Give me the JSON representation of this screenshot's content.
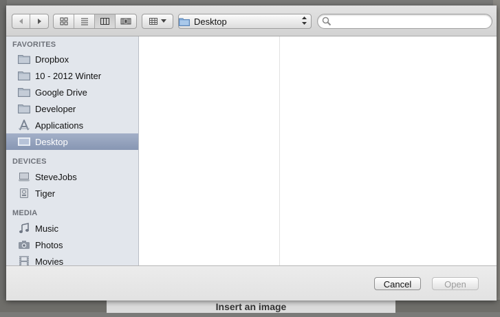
{
  "background": {
    "insert_label": "Insert an image"
  },
  "toolbar": {
    "nav": {
      "back_icon": "back-arrow-icon",
      "forward_icon": "forward-arrow-icon"
    },
    "views": [
      {
        "name": "icon-view",
        "icon": "icon-grid-icon",
        "active": false
      },
      {
        "name": "list-view",
        "icon": "list-lines-icon",
        "active": false
      },
      {
        "name": "column-view",
        "icon": "columns-icon",
        "active": true
      },
      {
        "name": "coverflow-view",
        "icon": "coverflow-icon",
        "active": false
      }
    ],
    "arrange_icon": "arrange-grid-icon",
    "location": "Desktop",
    "search_placeholder": ""
  },
  "sidebar": {
    "favorites_header": "FAVORITES",
    "favorites": [
      {
        "label": "Dropbox",
        "icon": "folder-icon"
      },
      {
        "label": "10 - 2012 Winter",
        "icon": "folder-icon"
      },
      {
        "label": "Google Drive",
        "icon": "folder-icon"
      },
      {
        "label": "Developer",
        "icon": "folder-icon"
      },
      {
        "label": "Applications",
        "icon": "applications-icon"
      },
      {
        "label": "Desktop",
        "icon": "desktop-icon",
        "selected": true
      }
    ],
    "devices_header": "DEVICES",
    "devices": [
      {
        "label": "SteveJobs",
        "icon": "laptop-icon"
      },
      {
        "label": "Tiger",
        "icon": "disk-icon"
      }
    ],
    "media_header": "MEDIA",
    "media": [
      {
        "label": "Music",
        "icon": "music-note-icon"
      },
      {
        "label": "Photos",
        "icon": "camera-icon"
      },
      {
        "label": "Movies",
        "icon": "film-icon"
      }
    ]
  },
  "buttons": {
    "cancel": "Cancel",
    "open": "Open"
  },
  "colors": {
    "selection": "#8f9db9",
    "sidebar_bg": "#e2e6ec"
  }
}
